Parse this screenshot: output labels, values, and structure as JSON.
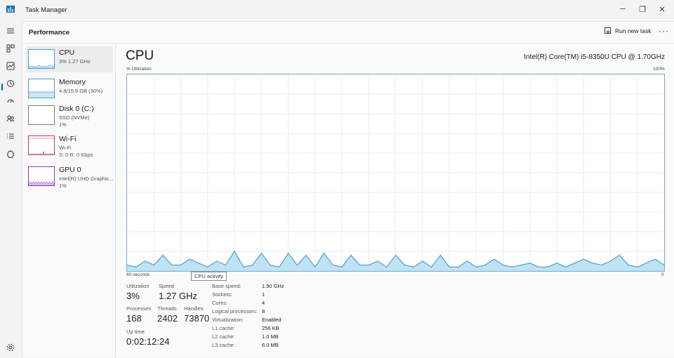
{
  "window": {
    "title": "Task Manager",
    "minimize_glyph": "─",
    "maximize_glyph": "❐",
    "close_glyph": "✕"
  },
  "toolbar": {
    "page_title": "Performance",
    "run_new_task": "Run new task",
    "more_glyph": "···"
  },
  "nav_rail": [
    "menu-icon",
    "processes-icon",
    "performance-icon",
    "app-history-icon",
    "startup-apps-icon",
    "users-icon",
    "details-icon",
    "services-icon",
    "settings-icon"
  ],
  "devices": [
    {
      "name": "CPU",
      "line1": "3%  1.27 GHz",
      "line2": "",
      "color": "#4a9fd4"
    },
    {
      "name": "Memory",
      "line1": "4.8/15.9 GB (30%)",
      "line2": "",
      "color": "#4a9fd4"
    },
    {
      "name": "Disk 0 (C:)",
      "line1": "SSD (NVMe)",
      "line2": "1%",
      "color": "#6c6c6c"
    },
    {
      "name": "Wi-Fi",
      "line1": "Wi-Fi",
      "line2": "S: 0  R: 0 Kbps",
      "color": "#c43a6b"
    },
    {
      "name": "GPU 0",
      "line1": "Intel(R) UHD Graphic...",
      "line2": "1%",
      "color": "#8a3bc9"
    }
  ],
  "cpu": {
    "title": "CPU",
    "model": "Intel(R) Core(TM) i5-8350U CPU @ 1.70GHz",
    "y_label": "% Utilization",
    "y_max": "100%",
    "x_left": "60 seconds",
    "x_right": "0",
    "tooltip": "CPU activity"
  },
  "chart_data": {
    "type": "area",
    "title": "",
    "xlabel": "",
    "ylabel": "% Utilization",
    "ylim": [
      0,
      100
    ],
    "xlim": [
      60,
      0
    ],
    "x_unit": "seconds",
    "grid": true,
    "series": [
      {
        "color": "#4a9fd4",
        "x": [
          60,
          59,
          58,
          57,
          56,
          55,
          54,
          53,
          52,
          51,
          50,
          49,
          48,
          47,
          46,
          45,
          44,
          43,
          42,
          41,
          40,
          39,
          38,
          37,
          36,
          35,
          34,
          33,
          32,
          31,
          30,
          29,
          28,
          27,
          26,
          25,
          24,
          23,
          22,
          21,
          20,
          19,
          18,
          17,
          16,
          15,
          14,
          13,
          12,
          11,
          10,
          9,
          8,
          7,
          6,
          5,
          4,
          3,
          2,
          1,
          0
        ],
        "values": [
          3,
          2,
          5,
          3,
          8,
          3,
          3,
          6,
          4,
          2,
          5,
          3,
          10,
          2,
          3,
          9,
          3,
          2,
          9,
          3,
          8,
          2,
          9,
          3,
          2,
          8,
          3,
          3,
          5,
          2,
          8,
          3,
          2,
          5,
          2,
          8,
          2,
          2,
          5,
          2,
          3,
          6,
          3,
          2,
          3,
          4,
          2,
          2,
          4,
          2,
          4,
          6,
          4,
          3,
          5,
          8,
          3,
          2,
          4,
          6,
          3
        ]
      }
    ]
  },
  "stats": {
    "utilization_label": "Utilization",
    "utilization": "3%",
    "speed_label": "Speed",
    "speed": "1.27 GHz",
    "processes_label": "Processes",
    "processes": "168",
    "threads_label": "Threads",
    "threads": "2402",
    "handles_label": "Handles",
    "handles": "73870",
    "uptime_label": "Up time",
    "uptime": "0:02:12:24"
  },
  "specs": [
    {
      "k": "Base speed:",
      "v": "1.90 GHz"
    },
    {
      "k": "Sockets:",
      "v": "1"
    },
    {
      "k": "Cores:",
      "v": "4"
    },
    {
      "k": "Logical processors:",
      "v": "8"
    },
    {
      "k": "Virtualization:",
      "v": "Enabled"
    },
    {
      "k": "L1 cache:",
      "v": "256 KB"
    },
    {
      "k": "L2 cache:",
      "v": "1.0 MB"
    },
    {
      "k": "L3 cache:",
      "v": "6.0 MB"
    }
  ]
}
